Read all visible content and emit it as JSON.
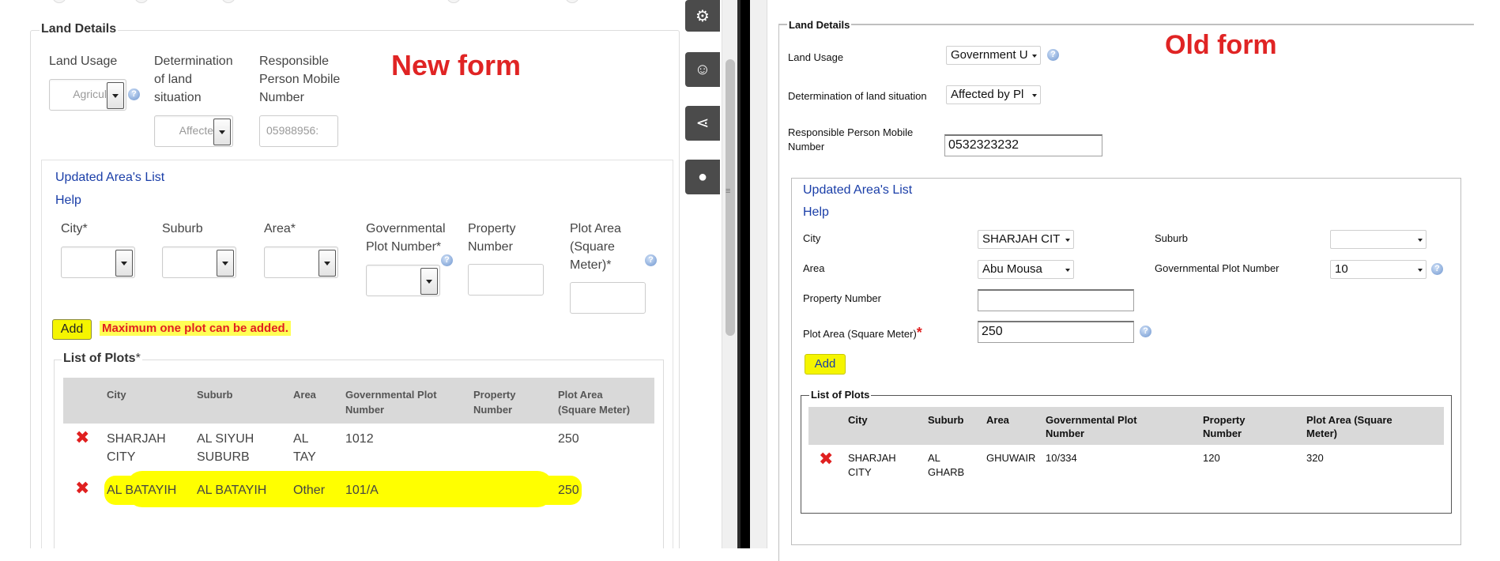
{
  "new_form": {
    "title": "New form",
    "legend": "Land Details",
    "land_usage": {
      "label": "Land Usage",
      "value": "Agricul"
    },
    "determination": {
      "label_lines": [
        "Determination",
        "of land",
        "situation"
      ],
      "value": "Affecte"
    },
    "mobile": {
      "label_lines": [
        "Responsible",
        "Person Mobile",
        "Number"
      ],
      "value": "05988956:"
    },
    "updated_areas_link": "Updated Area's List",
    "help_link": "Help",
    "fields": {
      "city": "City*",
      "suburb": "Suburb",
      "area": "Area*",
      "gov_plot_lines": [
        "Governmental",
        "Plot Number*"
      ],
      "property_lines": [
        "Property",
        "Number"
      ],
      "plot_area_lines": [
        "Plot Area",
        "(Square",
        "Meter)*"
      ]
    },
    "add_button": "Add",
    "warning": "Maximum one plot can be added.",
    "plots_legend": "List of Plots",
    "plots_legend_mark": "*",
    "columns": {
      "city": "City",
      "suburb": "Suburb",
      "area": "Area",
      "gov_plot": [
        "Governmental Plot",
        "Number"
      ],
      "property": [
        "Property",
        "Number"
      ],
      "plot_area": [
        "Plot Area",
        "(Square Meter)"
      ]
    },
    "rows": [
      {
        "city": [
          "SHARJAH",
          "CITY"
        ],
        "suburb": [
          "AL SIYUH",
          "SUBURB"
        ],
        "area": [
          "AL",
          "TAY"
        ],
        "gov_plot": "1012",
        "property": "",
        "plot_area": "250"
      },
      {
        "city": [
          "AL BATAYIH"
        ],
        "suburb": [
          "AL BATAYIH"
        ],
        "area": [
          "Other"
        ],
        "gov_plot": "101/A",
        "property": "",
        "plot_area": "250"
      }
    ],
    "delete_glyph": "✖"
  },
  "old_form": {
    "title": "Old form",
    "legend": "Land Details",
    "land_usage": {
      "label": "Land Usage",
      "value": "Government U"
    },
    "determination": {
      "label": "Determination of land situation",
      "value": "Affected by Pl"
    },
    "mobile": {
      "label_lines": [
        "Responsible Person Mobile",
        "Number"
      ],
      "value": "0532323232"
    },
    "updated_areas_link": "Updated Area's List",
    "help_link": "Help",
    "city": {
      "label": "City",
      "value": "SHARJAH CIT"
    },
    "suburb": {
      "label": "Suburb",
      "value": ""
    },
    "area": {
      "label": "Area",
      "value": "Abu Mousa"
    },
    "gov_plot": {
      "label": "Governmental Plot Number",
      "value": "10"
    },
    "property": {
      "label": "Property Number",
      "value": ""
    },
    "plot_area": {
      "label": "Plot Area (Square Meter)",
      "required_mark": "*",
      "value": "250"
    },
    "add_button": "Add",
    "plots_legend": "List of Plots",
    "columns": {
      "city": "City",
      "suburb": "Suburb",
      "area": "Area",
      "gov_plot": [
        "Governmental Plot",
        "Number"
      ],
      "property": [
        "Property",
        "Number"
      ],
      "plot_area": [
        "Plot Area (Square",
        "Meter)"
      ]
    },
    "rows": [
      {
        "city": [
          "SHARJAH",
          "CITY"
        ],
        "suburb": [
          "AL",
          "GHARB"
        ],
        "area": "GHUWAIR",
        "gov_plot": "10/334",
        "property": "120",
        "plot_area": "320"
      }
    ],
    "delete_glyph": "✖"
  },
  "side_rail": {
    "icons": [
      "gear-icon",
      "smiley-icon",
      "share-icon",
      "chat-icon"
    ],
    "glyphs": [
      "⚙",
      "☺",
      "⋖",
      "●"
    ]
  },
  "colors": {
    "title_red": "#e02424",
    "highlight_yellow": "#ffff00",
    "link_blue": "#1a3ea8",
    "header_gray": "#d9d9d9"
  }
}
